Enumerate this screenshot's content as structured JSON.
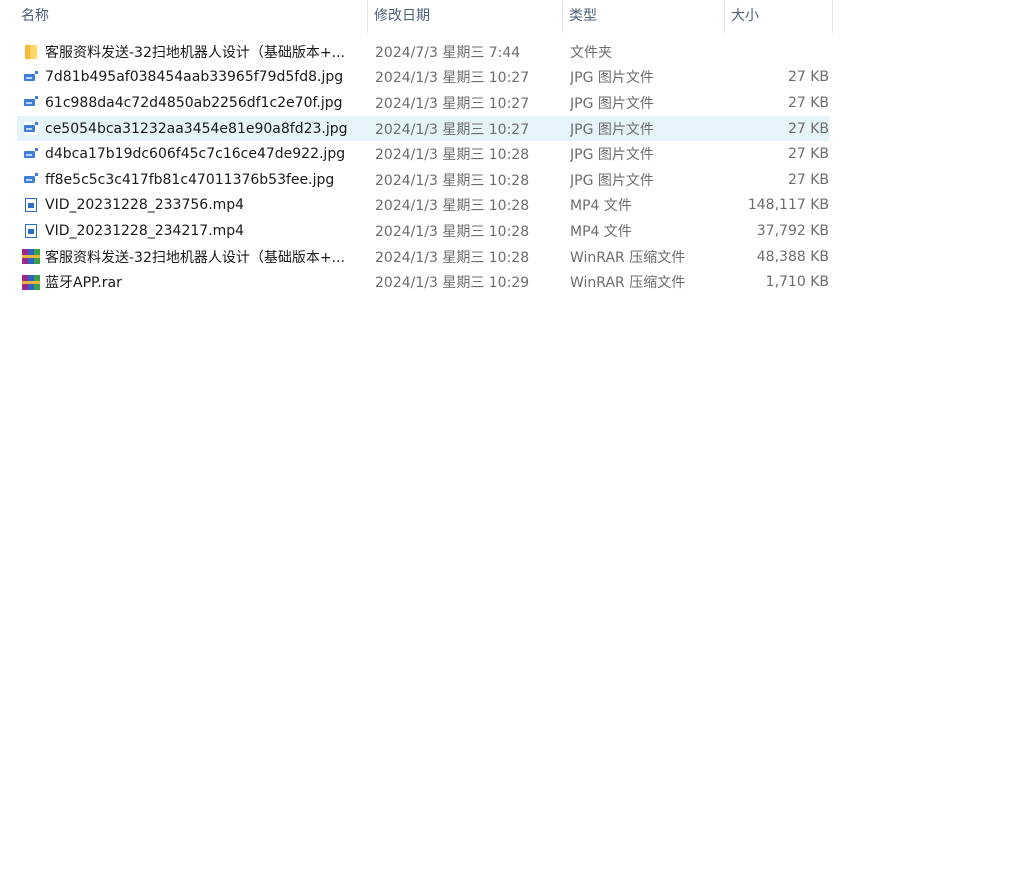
{
  "header": {
    "sort_arrow": "^",
    "columns": {
      "name": "名称",
      "date": "修改日期",
      "type": "类型",
      "size": "大小"
    }
  },
  "files": [
    {
      "icon": "folder-icon",
      "name": "客服资料发送-32扫地机器人设计（基础版本+...",
      "date": "2024/7/3 星期三 7:44",
      "type": "文件夹",
      "size": ""
    },
    {
      "icon": "jpg-file-icon",
      "name": "7d81b495af038454aab33965f79d5fd8.jpg",
      "date": "2024/1/3 星期三 10:27",
      "type": "JPG 图片文件",
      "size": "27 KB"
    },
    {
      "icon": "jpg-file-icon",
      "name": "61c988da4c72d4850ab2256df1c2e70f.jpg",
      "date": "2024/1/3 星期三 10:27",
      "type": "JPG 图片文件",
      "size": "27 KB"
    },
    {
      "icon": "jpg-file-icon",
      "name": "ce5054bca31232aa3454e81e90a8fd23.jpg",
      "date": "2024/1/3 星期三 10:27",
      "type": "JPG 图片文件",
      "size": "27 KB",
      "selected": true
    },
    {
      "icon": "jpg-file-icon",
      "name": "d4bca17b19dc606f45c7c16ce47de922.jpg",
      "date": "2024/1/3 星期三 10:28",
      "type": "JPG 图片文件",
      "size": "27 KB"
    },
    {
      "icon": "jpg-file-icon",
      "name": "ff8e5c5c3c417fb81c47011376b53fee.jpg",
      "date": "2024/1/3 星期三 10:28",
      "type": "JPG 图片文件",
      "size": "27 KB"
    },
    {
      "icon": "mp4-file-icon",
      "name": "VID_20231228_233756.mp4",
      "date": "2024/1/3 星期三 10:28",
      "type": "MP4 文件",
      "size": "148,117 KB"
    },
    {
      "icon": "mp4-file-icon",
      "name": "VID_20231228_234217.mp4",
      "date": "2024/1/3 星期三 10:28",
      "type": "MP4 文件",
      "size": "37,792 KB"
    },
    {
      "icon": "rar-file-icon",
      "name": "客服资料发送-32扫地机器人设计（基础版本+...",
      "date": "2024/1/3 星期三 10:28",
      "type": "WinRAR 压缩文件",
      "size": "48,388 KB"
    },
    {
      "icon": "rar-file-icon",
      "name": "蓝牙APP.rar",
      "date": "2024/1/3 星期三 10:29",
      "type": "WinRAR 压缩文件",
      "size": "1,710 KB"
    }
  ],
  "colors": {
    "header_text": "#4c607a",
    "selected_row": "#e5f3fb",
    "secondary_text": "#6d6d6d"
  }
}
